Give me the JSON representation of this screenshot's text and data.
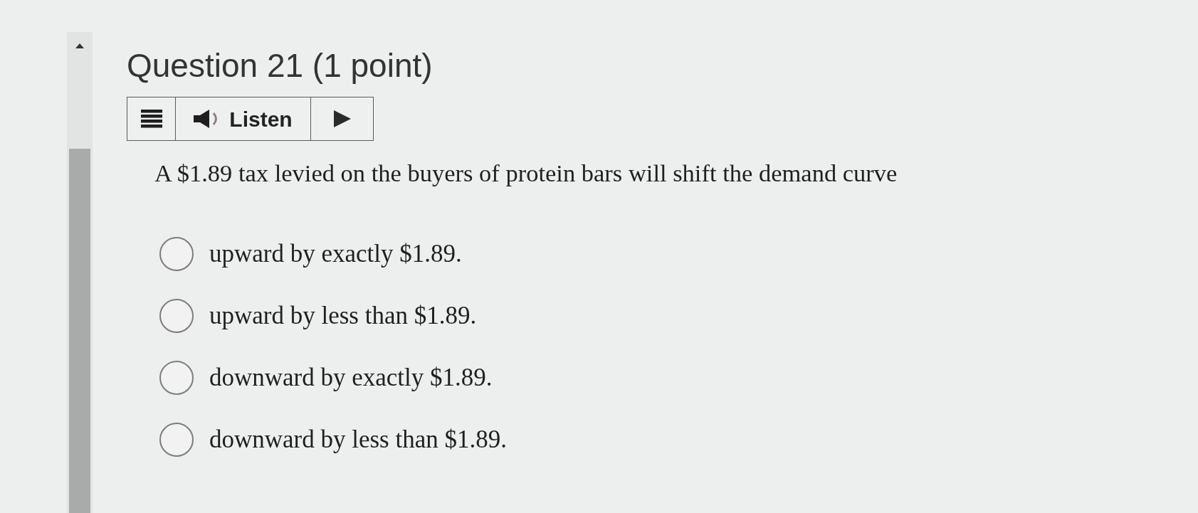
{
  "question": {
    "title": "Question 21 (1 point)",
    "listen_bar": {
      "label": "Listen"
    },
    "prompt": "A $1.89 tax levied on the buyers of protein bars will shift the demand curve",
    "options": [
      {
        "label": "upward by exactly $1.89.",
        "selected": false
      },
      {
        "label": "upward by less than $1.89.",
        "selected": false
      },
      {
        "label": "downward by exactly $1.89.",
        "selected": false
      },
      {
        "label": "downward by less than $1.89.",
        "selected": false
      }
    ]
  }
}
